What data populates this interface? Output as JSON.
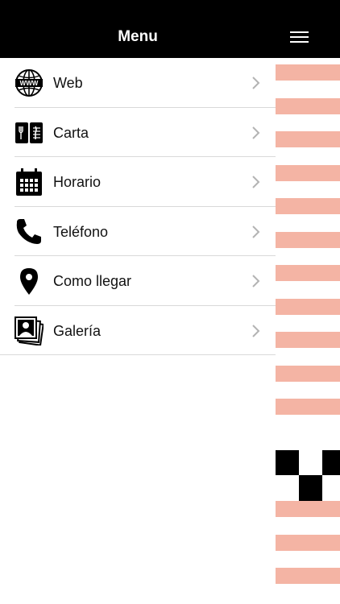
{
  "header": {
    "title": "Menu",
    "menu_icon": "hamburger-icon"
  },
  "menu": {
    "items": [
      {
        "label": "Web",
        "icon": "www-globe-icon"
      },
      {
        "label": "Carta",
        "icon": "menu-book-icon"
      },
      {
        "label": "Horario",
        "icon": "calendar-icon"
      },
      {
        "label": "Teléfono",
        "icon": "phone-icon"
      },
      {
        "label": "Como llegar",
        "icon": "map-pin-icon"
      },
      {
        "label": "Galería",
        "icon": "photo-gallery-icon"
      }
    ]
  },
  "colors": {
    "header_bg": "#000000",
    "stripe": "#f4b4a4",
    "separator": "#d9d9d9",
    "chevron": "#b3b3b3"
  }
}
